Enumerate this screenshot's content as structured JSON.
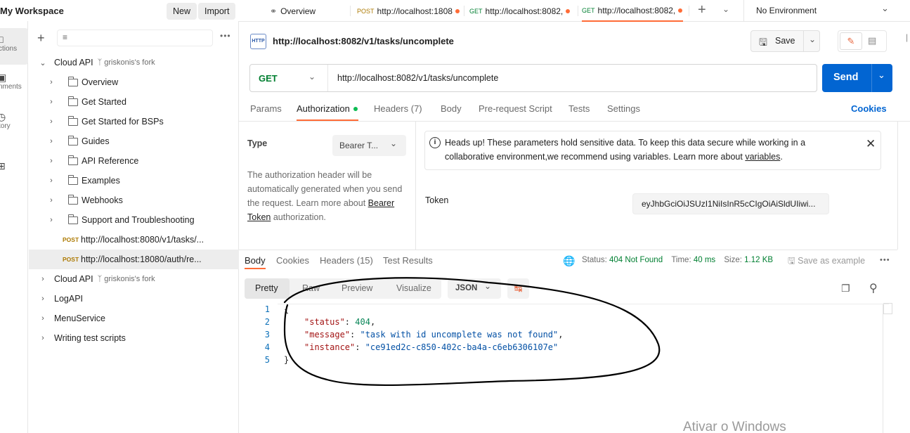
{
  "workspace": {
    "title": "My Workspace",
    "new_label": "New",
    "import_label": "Import"
  },
  "rail": {
    "items": [
      {
        "label": "ctions",
        "icon": "collections-icon"
      },
      {
        "label": "nments",
        "icon": "environments-icon"
      },
      {
        "label": "tory",
        "icon": "history-icon"
      },
      {
        "label": "",
        "icon": "apps-icon"
      }
    ]
  },
  "sidebar": {
    "tree": [
      {
        "type": "collection",
        "label": "Cloud API",
        "fork": "griskonis's fork",
        "expanded": true
      },
      {
        "type": "folder",
        "label": "Overview"
      },
      {
        "type": "folder",
        "label": "Get Started"
      },
      {
        "type": "folder",
        "label": "Get Started for BSPs"
      },
      {
        "type": "folder",
        "label": "Guides"
      },
      {
        "type": "folder",
        "label": "API Reference"
      },
      {
        "type": "folder",
        "label": "Examples"
      },
      {
        "type": "folder",
        "label": "Webhooks"
      },
      {
        "type": "folder",
        "label": "Support and Troubleshooting"
      },
      {
        "type": "request",
        "method": "POST",
        "label": "http://localhost:8080/v1/tasks/..."
      },
      {
        "type": "request",
        "method": "POST",
        "label": "http://localhost:18080/auth/re...",
        "selected": true
      },
      {
        "type": "collection",
        "label": "Cloud API",
        "fork": "griskonis's fork",
        "expanded": false
      },
      {
        "type": "collection",
        "label": "LogAPI"
      },
      {
        "type": "collection",
        "label": "MenuService"
      },
      {
        "type": "collection",
        "label": "Writing test scripts"
      }
    ]
  },
  "tabs": {
    "overview": "Overview",
    "items": [
      {
        "method": "POST",
        "label": "http://localhost:1808"
      },
      {
        "method": "GET",
        "label": "http://localhost:8082,"
      },
      {
        "method": "GET",
        "label": "http://localhost:8082,",
        "active": true
      }
    ],
    "environment": "No Environment"
  },
  "request": {
    "title": "http://localhost:8082/v1/tasks/uncomplete",
    "http_badge": "HTTP",
    "save_label": "Save",
    "method": "GET",
    "url": "http://localhost:8082/v1/tasks/uncomplete",
    "send_label": "Send",
    "subtabs": [
      "Params",
      "Authorization",
      "Headers (7)",
      "Body",
      "Pre-request Script",
      "Tests",
      "Settings"
    ],
    "cookies_label": "Cookies"
  },
  "auth": {
    "type_label": "Type",
    "type_value": "Bearer T...",
    "description": "The authorization header will be automatically generated when you send the request. Learn more about",
    "link_text": "Bearer Token",
    "description_end": "authorization.",
    "note": "Heads up! These parameters hold sensitive data. To keep this data secure while working in a collaborative environment,we recommend using variables. Learn more about",
    "note_link": "variables",
    "note_end": ".",
    "token_label": "Token",
    "token_value": "eyJhbGciOiJSUzI1NiIsInR5cCIgOiAiSldUIiwi..."
  },
  "response": {
    "tabs": [
      "Body",
      "Cookies",
      "Headers (15)",
      "Test Results"
    ],
    "status_label": "Status:",
    "status_value": "404 Not Found",
    "time_label": "Time:",
    "time_value": "40 ms",
    "size_label": "Size:",
    "size_value": "1.12 KB",
    "save_example": "Save as example",
    "view_modes": [
      "Pretty",
      "Raw",
      "Preview",
      "Visualize"
    ],
    "format": "JSON",
    "lines": [
      {
        "n": "1",
        "text": "{"
      },
      {
        "n": "2",
        "key": "\"status\"",
        "value": "404",
        "kind": "num",
        "tail": ","
      },
      {
        "n": "3",
        "key": "\"message\"",
        "value": "\"task with id uncomplete was not found\"",
        "kind": "str",
        "tail": ","
      },
      {
        "n": "4",
        "key": "\"instance\"",
        "value": "\"ce91ed2c-c850-402c-ba4a-c6eb6306107e\"",
        "kind": "str",
        "tail": ""
      },
      {
        "n": "5",
        "text": "}"
      }
    ]
  },
  "watermark": "Ativar o Windows",
  "colors": {
    "accent": "#ff6c37",
    "send": "#0265d2",
    "get": "#007f31",
    "post": "#ad7a03",
    "status_ok_green": "#007f31"
  }
}
